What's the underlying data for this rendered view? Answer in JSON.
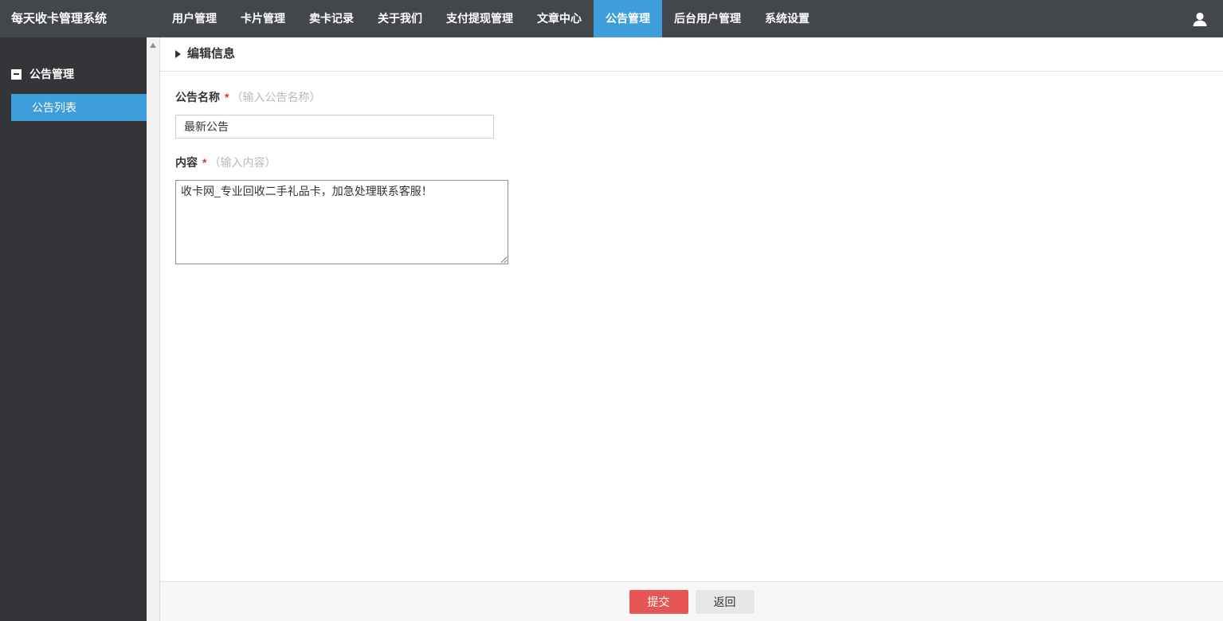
{
  "app": {
    "title": "每天收卡管理系统"
  },
  "navbar": {
    "items": [
      {
        "label": "用户管理",
        "active": false
      },
      {
        "label": "卡片管理",
        "active": false
      },
      {
        "label": "卖卡记录",
        "active": false
      },
      {
        "label": "关于我们",
        "active": false
      },
      {
        "label": "支付提现管理",
        "active": false
      },
      {
        "label": "文章中心",
        "active": false
      },
      {
        "label": "公告管理",
        "active": true
      },
      {
        "label": "后台用户管理",
        "active": false
      },
      {
        "label": "系统设置",
        "active": false
      }
    ],
    "user_icon": "person-silhouette"
  },
  "sidebar": {
    "group_label": "公告管理",
    "collapse_icon": "square-minus",
    "items": [
      {
        "label": "公告列表",
        "active": true
      }
    ]
  },
  "main": {
    "section_title": "编辑信息",
    "form": {
      "name_field": {
        "label": "公告名称",
        "required_mark": "*",
        "hint": "（输入公告名称）",
        "value": "最新公告"
      },
      "content_field": {
        "label": "内容",
        "required_mark": "*",
        "hint": "（输入内容）",
        "value": "收卡网_专业回收二手礼品卡，加急处理联系客服！"
      }
    },
    "footer": {
      "submit_label": "提交",
      "back_label": "返回"
    }
  },
  "colors": {
    "navbar_bg": "#43464b",
    "sidebar_bg": "#333538",
    "accent_blue": "#3e9ddb",
    "submit_red": "#e85555"
  }
}
